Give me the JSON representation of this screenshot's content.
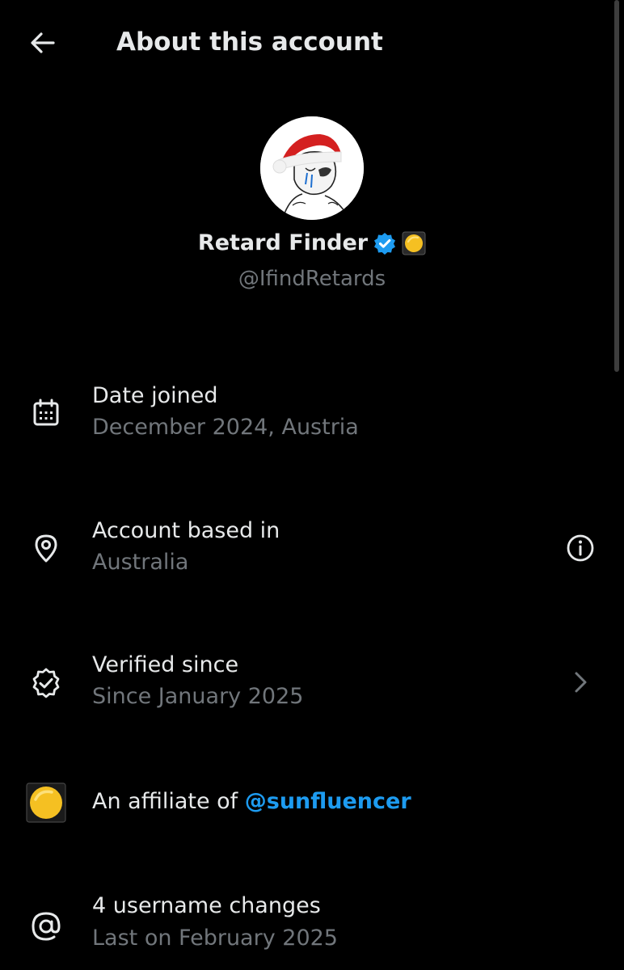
{
  "header": {
    "title": "About this account",
    "back_icon": "arrow-left-icon"
  },
  "profile": {
    "display_name": "Retard Finder",
    "handle": "@IfindRetards",
    "verified_badge": "verified-badge-icon",
    "affiliate_badge": "sun-badge-icon",
    "verified_color": "#1d9bf0"
  },
  "rows": {
    "date_joined": {
      "label": "Date joined",
      "value": "December 2024, Austria",
      "icon": "calendar-icon"
    },
    "based_in": {
      "label": "Account based in",
      "value": "Australia",
      "icon": "location-pin-icon",
      "trail_icon": "info-icon"
    },
    "verified": {
      "label": "Verified since",
      "value": "Since January 2025",
      "icon": "verified-outline-icon",
      "trail_icon": "chevron-right-icon"
    },
    "affiliate": {
      "prefix": "An affiliate of ",
      "link": "@sunfluencer",
      "icon": "sun-affiliate-icon"
    },
    "username_changes": {
      "label": "4 username changes",
      "value": "Last on February 2025",
      "icon": "at-sign-icon"
    }
  },
  "colors": {
    "background": "#000000",
    "primary_text": "#e7e9ea",
    "secondary_text": "#71767b",
    "accent": "#1d9bf0"
  }
}
